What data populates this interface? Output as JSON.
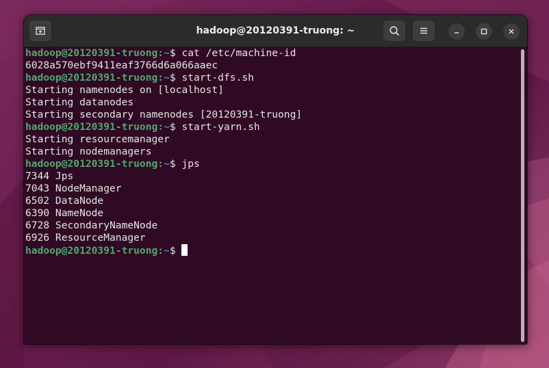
{
  "window": {
    "title": "hadoop@20120391-truong: ~"
  },
  "titlebar": {
    "new_tab_icon": "new-tab-icon",
    "search_icon": "search-icon",
    "menu_icon": "hamburger-menu-icon",
    "minimize_icon": "minimize-icon",
    "maximize_icon": "maximize-icon",
    "close_icon": "close-icon"
  },
  "colors": {
    "terminal_bg": "#300a24",
    "prompt_user": "#4fa86e",
    "prompt_path": "#4f83c2",
    "text": "#e6e6e6"
  },
  "prompt": {
    "user_host": "hadoop@20120391-truong",
    "separator": ":",
    "path": "~",
    "symbol": "$ "
  },
  "terminal": {
    "lines": [
      {
        "type": "prompt",
        "cmd": "cat /etc/machine-id"
      },
      {
        "type": "output",
        "text": "6028a570ebf9411eaf3766d6a066aaec"
      },
      {
        "type": "prompt",
        "cmd": "start-dfs.sh"
      },
      {
        "type": "output",
        "text": "Starting namenodes on [localhost]"
      },
      {
        "type": "output",
        "text": "Starting datanodes"
      },
      {
        "type": "output",
        "text": "Starting secondary namenodes [20120391-truong]"
      },
      {
        "type": "prompt",
        "cmd": "start-yarn.sh"
      },
      {
        "type": "output",
        "text": "Starting resourcemanager"
      },
      {
        "type": "output",
        "text": "Starting nodemanagers"
      },
      {
        "type": "prompt",
        "cmd": "jps"
      },
      {
        "type": "output",
        "text": "7344 Jps"
      },
      {
        "type": "output",
        "text": "7043 NodeManager"
      },
      {
        "type": "output",
        "text": "6502 DataNode"
      },
      {
        "type": "output",
        "text": "6390 NameNode"
      },
      {
        "type": "output",
        "text": "6728 SecondaryNameNode"
      },
      {
        "type": "output",
        "text": "6926 ResourceManager"
      },
      {
        "type": "prompt",
        "cmd": "",
        "cursor": true
      }
    ]
  }
}
